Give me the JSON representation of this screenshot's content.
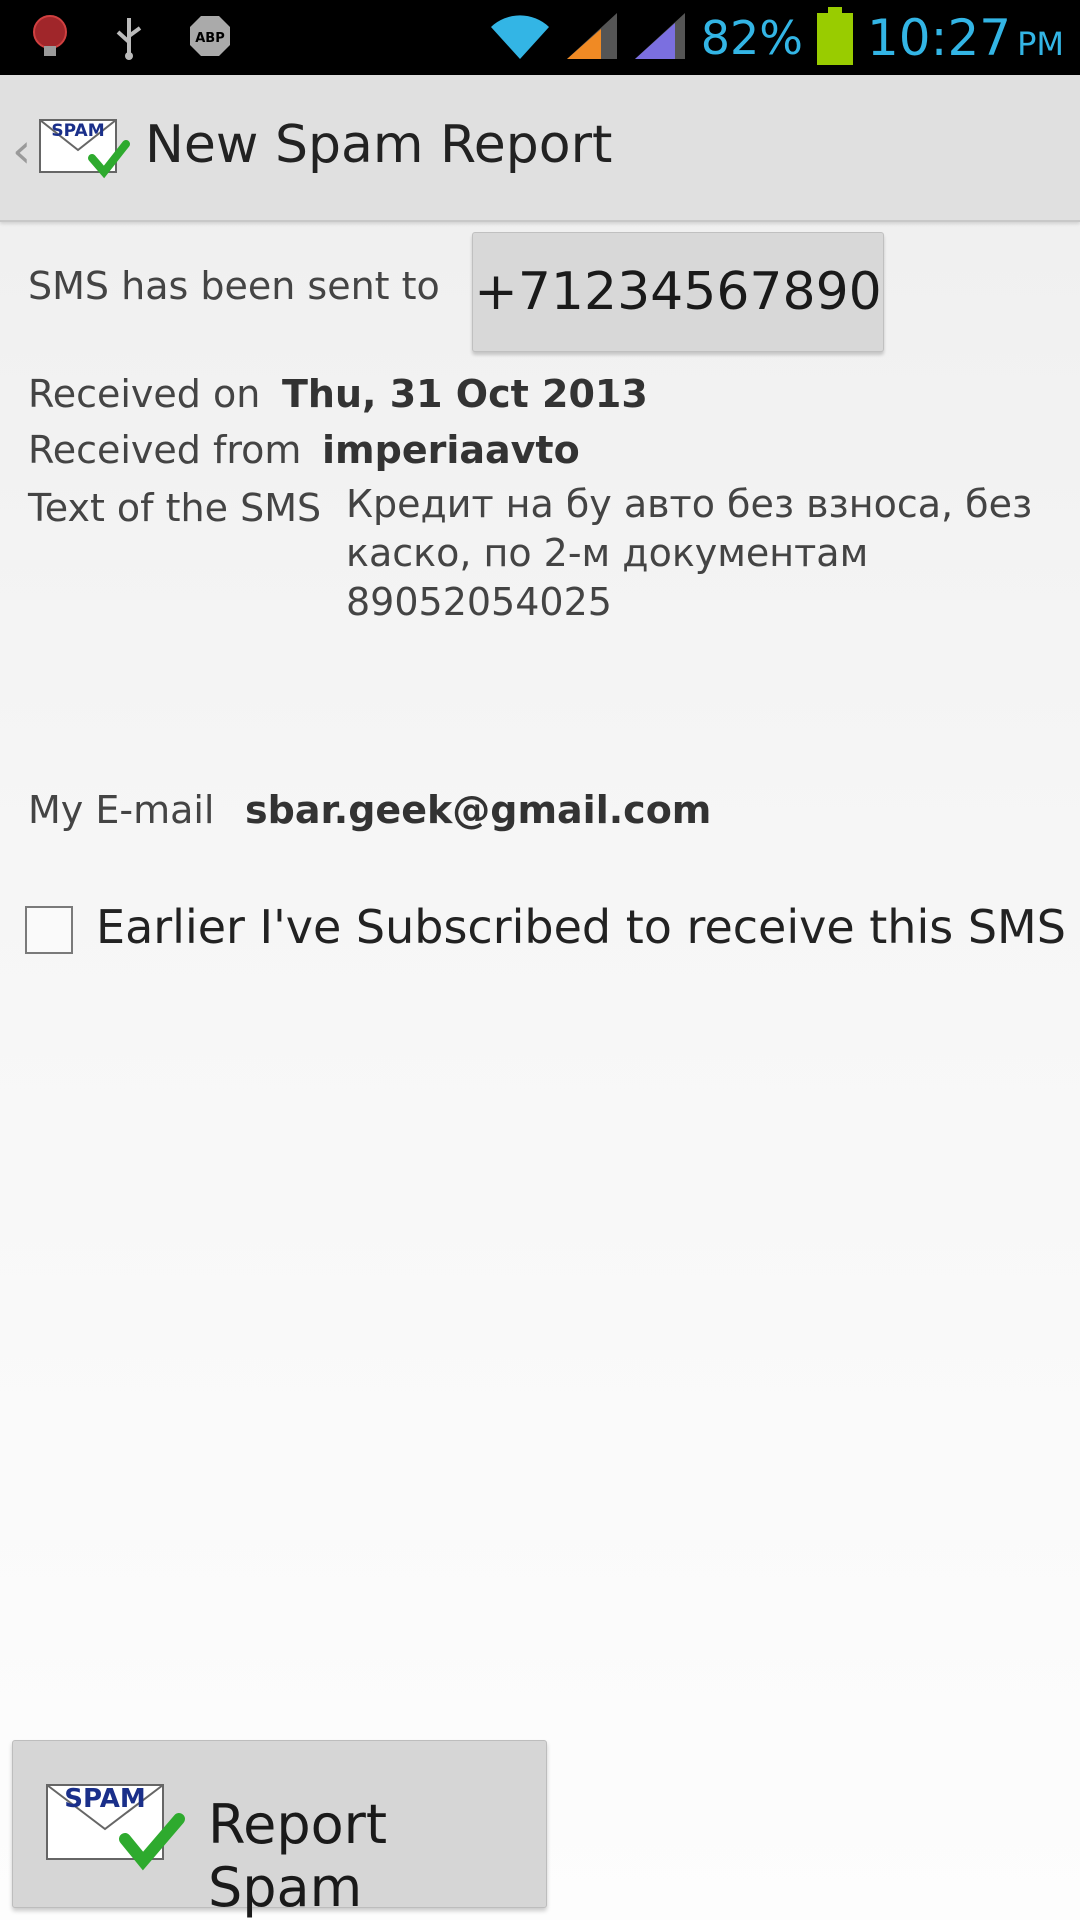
{
  "status_bar": {
    "battery_percent": "82%",
    "time": "10:27",
    "ampm": "PM",
    "icons": [
      "bug-icon",
      "usb-icon",
      "adblock-icon",
      "wifi-icon",
      "signal-icon",
      "signal-icon",
      "battery-icon"
    ],
    "abp_text": "ABP"
  },
  "action_bar": {
    "title": "New Spam Report",
    "icon_text": "SPAM"
  },
  "report": {
    "sent_to_label": "SMS has been sent to",
    "sent_to_number": "+71234567890",
    "received_on_label": "Received on",
    "received_on_value": "Thu, 31 Oct 2013",
    "received_from_label": "Received from",
    "received_from_value": "imperiaavto",
    "text_label": "Text of the SMS",
    "text_value": "Кредит на бу авто без взноса, без каско, по 2-м документам 89052054025",
    "email_label": "My E-mail",
    "email_value": "sbar.geek@gmail.com",
    "subscribed_label": "Earlier I've Subscribed to receive this SMS",
    "subscribed_checked": false
  },
  "footer": {
    "report_button_label": "Report Spam",
    "report_icon_text": "SPAM"
  },
  "colors": {
    "status_accent": "#33b5e5",
    "battery_green": "#99cc00",
    "check_green": "#2eaa2e"
  }
}
